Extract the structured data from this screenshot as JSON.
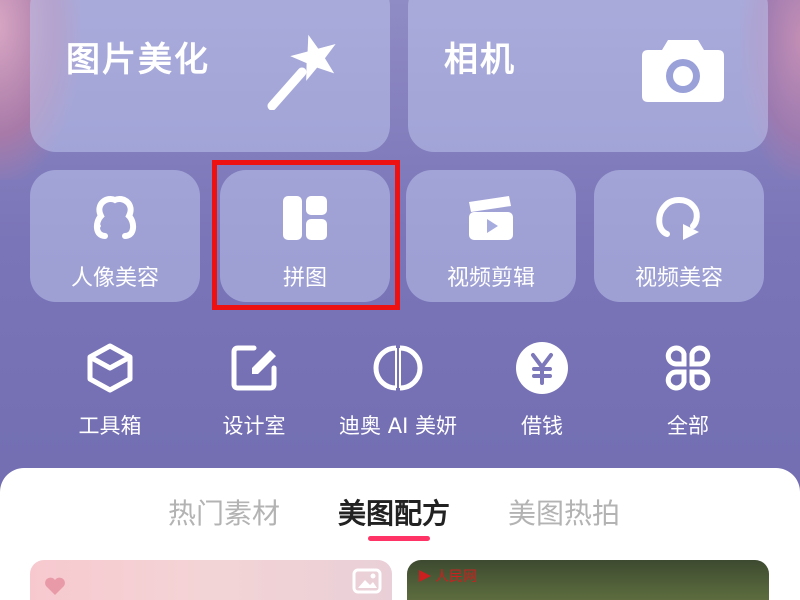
{
  "feature_cards": {
    "photo_edit": {
      "label": "图片美化",
      "icon": "magic-wand-icon"
    },
    "camera": {
      "label": "相机",
      "icon": "camera-icon"
    }
  },
  "quick_tools": [
    {
      "label": "人像美容",
      "icon": "face-retouch-icon"
    },
    {
      "label": "拼图",
      "icon": "collage-icon"
    },
    {
      "label": "视频剪辑",
      "icon": "video-clapper-icon"
    },
    {
      "label": "视频美容",
      "icon": "video-face-icon"
    }
  ],
  "tools_row": [
    {
      "label": "工具箱",
      "icon": "toolbox-cube-icon"
    },
    {
      "label": "设计室",
      "icon": "edit-pencil-icon"
    },
    {
      "label": "迪奥 AI 美妍",
      "icon": "dior-cd-logo-icon"
    },
    {
      "label": "借钱",
      "icon": "yuan-coin-icon"
    },
    {
      "label": "全部",
      "icon": "grid-clover-icon"
    }
  ],
  "content_tabs": [
    {
      "label": "热门素材",
      "active": false
    },
    {
      "label": "美图配方",
      "active": true
    },
    {
      "label": "美图热拍",
      "active": false
    }
  ],
  "thumbnails": {
    "right_logo_text": "人民网"
  },
  "colors": {
    "highlight_border": "#ee1111",
    "tab_indicator": "#ff3366"
  }
}
